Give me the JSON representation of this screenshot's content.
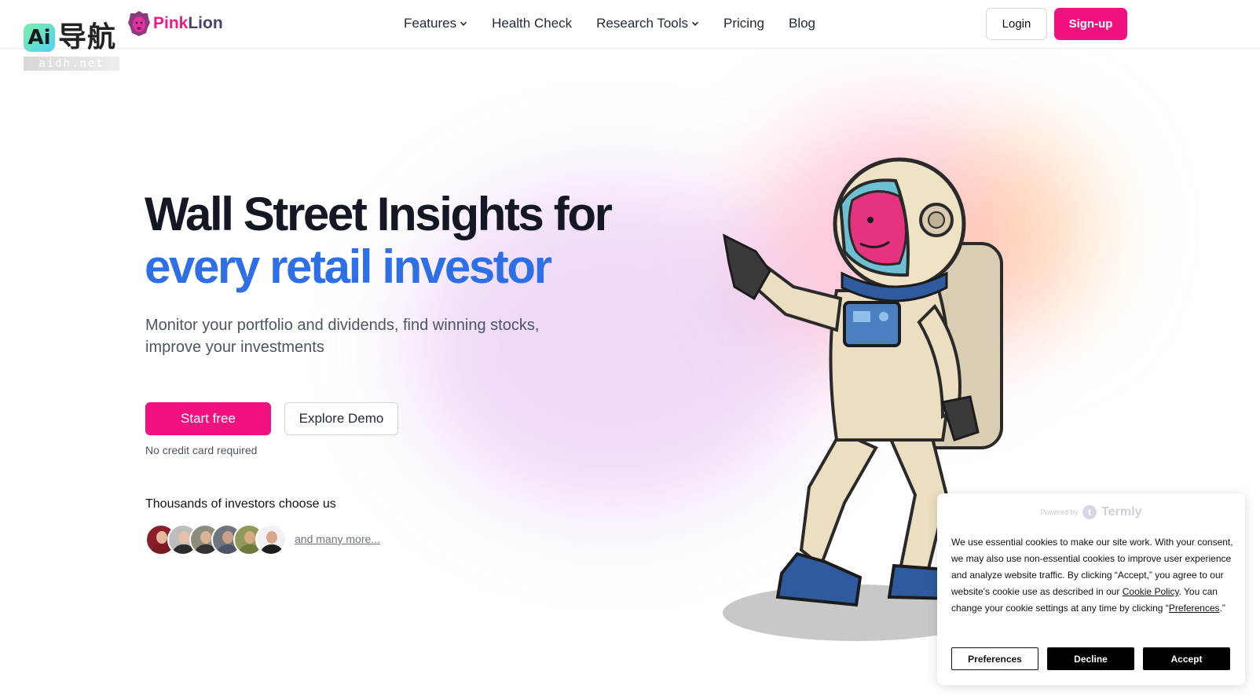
{
  "watermark": {
    "mark": "Ai",
    "name": "导航",
    "domain": "aidh.net"
  },
  "brand": {
    "name_part1": "Pink",
    "name_part2": "Lion",
    "accent_color": "#ea1c85"
  },
  "nav": {
    "items": [
      {
        "label": "Features",
        "has_dropdown": true
      },
      {
        "label": "Health Check",
        "has_dropdown": false
      },
      {
        "label": "Research Tools",
        "has_dropdown": true
      },
      {
        "label": "Pricing",
        "has_dropdown": false
      },
      {
        "label": "Blog",
        "has_dropdown": false
      }
    ],
    "login_label": "Login",
    "signup_label": "Sign-up"
  },
  "hero": {
    "title": "Wall Street Insights for",
    "title_accent": "every retail investor",
    "subtitle": "Monitor your portfolio and dividends, find winning stocks, improve your investments",
    "cta_primary": "Start free",
    "cta_secondary": "Explore Demo",
    "note": "No credit card required",
    "social_title": "Thousands of investors choose us",
    "more_link": "and many more..."
  },
  "cookie": {
    "powered_by": "Powered by",
    "provider": "Termly",
    "text_1": "We use essential cookies to make our site work. With your consent, we may also use non-essential cookies to improve user experience and analyze website traffic. By clicking “Accept,” you agree to our website's cookie use as described in our ",
    "link_cookie_policy": "Cookie Policy",
    "text_2": ". You can change your cookie settings at any time by clicking “",
    "link_preferences": "Preferences",
    "text_3": ".”",
    "preferences_label": "Preferences",
    "decline_label": "Decline",
    "accept_label": "Accept"
  },
  "colors": {
    "primary": "#f1127f",
    "accent_blue": "#2f6fe6",
    "heading": "#141824"
  }
}
